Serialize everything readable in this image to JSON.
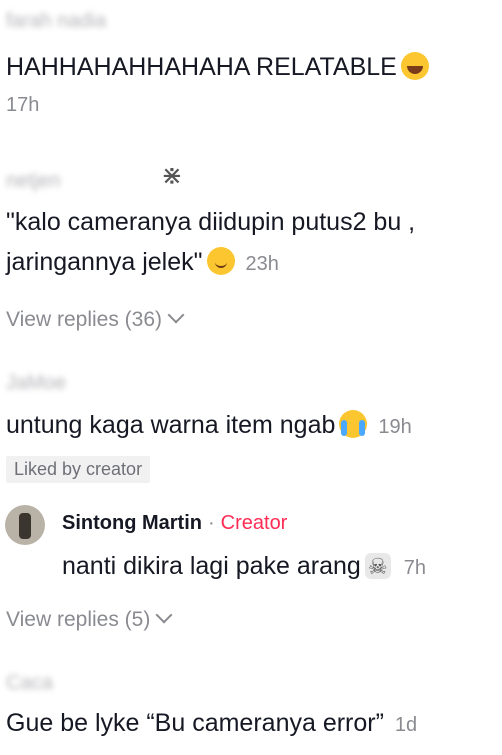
{
  "comments": [
    {
      "username": "farah nadia",
      "text": "HAHHAHAHHAHAHA RELATABLE",
      "emoji": "laughing-with-tears-emoji",
      "time": "17h"
    },
    {
      "username": "netjen",
      "text_line1": "\"kalo cameranya diidupin putus2 bu ,",
      "text_line2": "jaringannya jelek\"",
      "emoji": "relieved-face-emoji",
      "time": "23h",
      "view_replies": "View replies (36)"
    },
    {
      "username": "JaMoe",
      "text": "untung kaga warna item ngab",
      "emoji": "loudly-crying-emoji",
      "time": "19h",
      "liked_by": "Liked by creator",
      "reply": {
        "name": "Sintong Martin",
        "separator": "·",
        "badge": "Creator",
        "text": "nanti dikira lagi pake arang",
        "emoji": "skull-crossbones-emoji",
        "time": "7h"
      },
      "view_replies": "View replies (5)"
    },
    {
      "username": "Caca",
      "text": "Gue be lyke “Bu cameranya error”",
      "time": "1d"
    }
  ],
  "colors": {
    "creator": "#fe2c55",
    "meta": "#8a8b91",
    "text": "#161823"
  }
}
